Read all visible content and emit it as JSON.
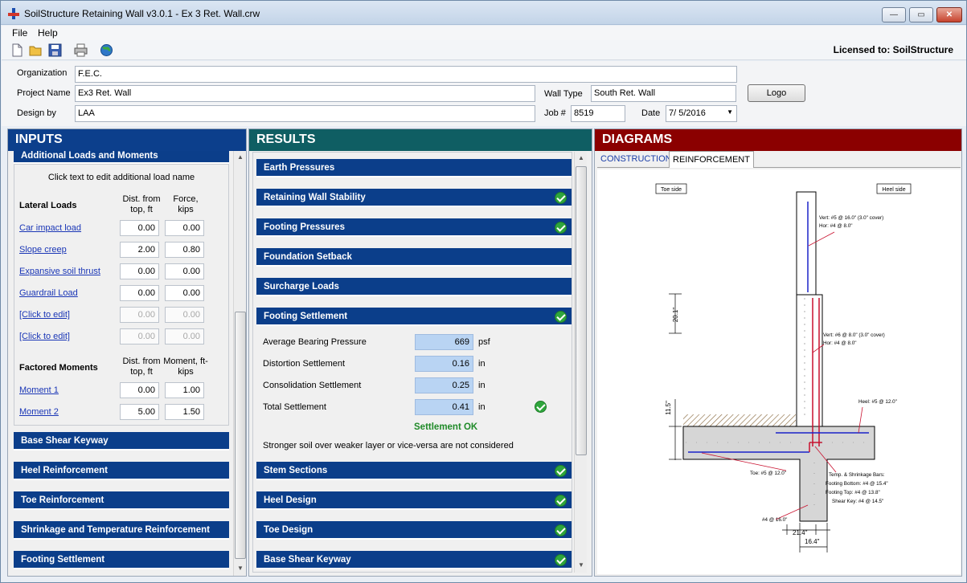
{
  "window": {
    "title": "SoilStructure Retaining Wall v3.0.1 - Ex 3 Ret. Wall.crw"
  },
  "menu": {
    "file": "File",
    "help": "Help"
  },
  "license": "Licensed to: SoilStructure",
  "header": {
    "organization_label": "Organization",
    "organization_value": "F.E.C.",
    "project_label": "Project Name",
    "project_value": "Ex3 Ret. Wall",
    "design_label": "Design by",
    "design_value": "LAA",
    "wall_type_label": "Wall Type",
    "wall_type_value": "South Ret. Wall",
    "job_label": "Job #",
    "job_value": "8519",
    "date_label": "Date",
    "date_value": "7/ 5/2016",
    "logo_button": "Logo"
  },
  "inputs": {
    "title": "INPUTS",
    "section_title": "Additional Loads and Moments",
    "hint": "Click text to edit additional load name",
    "lateral_title": "Lateral Loads",
    "lateral_col1": "Dist. from top, ft",
    "lateral_col2": "Force, kips",
    "lateral_rows": [
      {
        "name": "Car impact load",
        "dist": "0.00",
        "force": "0.00"
      },
      {
        "name": "Slope creep",
        "dist": "2.00",
        "force": "0.80"
      },
      {
        "name": "Expansive soil thrust",
        "dist": "0.00",
        "force": "0.00"
      },
      {
        "name": "Guardrail Load",
        "dist": "0.00",
        "force": "0.00"
      },
      {
        "name": "[Click to edit]",
        "dist": "0.00",
        "force": "0.00"
      },
      {
        "name": "[Click to edit]",
        "dist": "0.00",
        "force": "0.00"
      }
    ],
    "moments_title": "Factored Moments",
    "moments_col1": "Dist. from top, ft",
    "moments_col2": "Moment, ft-kips",
    "moment_rows": [
      {
        "name": "Moment 1",
        "dist": "0.00",
        "moment": "1.00"
      },
      {
        "name": "Moment 2",
        "dist": "5.00",
        "moment": "1.50"
      }
    ],
    "bars": [
      "Base Shear Keyway",
      "Heel Reinforcement",
      "Toe Reinforcement",
      "Shrinkage and Temperature Reinforcement",
      "Footing Settlement"
    ]
  },
  "results": {
    "title": "RESULTS",
    "bars_top": [
      {
        "label": "Earth Pressures",
        "ok": false
      },
      {
        "label": "Retaining Wall Stability",
        "ok": true
      },
      {
        "label": "Footing Pressures",
        "ok": true
      },
      {
        "label": "Foundation Setback",
        "ok": false
      },
      {
        "label": "Surcharge Loads",
        "ok": false
      },
      {
        "label": "Footing Settlement",
        "ok": true
      }
    ],
    "settlement": {
      "rows": [
        {
          "label": "Average Bearing Pressure",
          "value": "669",
          "unit": "psf"
        },
        {
          "label": "Distortion Settlement",
          "value": "0.16",
          "unit": "in"
        },
        {
          "label": "Consolidation Settlement",
          "value": "0.25",
          "unit": "in"
        },
        {
          "label": "Total Settlement",
          "value": "0.41",
          "unit": "in"
        }
      ],
      "status": "Settlement OK",
      "note": "Stronger soil over weaker layer or vice-versa are not considered"
    },
    "bars_bottom": [
      {
        "label": "Stem Sections",
        "ok": true
      },
      {
        "label": "Heel Design",
        "ok": true
      },
      {
        "label": "Toe Design",
        "ok": true
      },
      {
        "label": "Base Shear Keyway",
        "ok": true
      }
    ]
  },
  "diagrams": {
    "title": "DIAGRAMS",
    "tab_construction": "CONSTRUCTION",
    "tab_reinforcement": "REINFORCEMENT",
    "toe_side": "Toe side",
    "heel_side": "Heel side",
    "vert_upper": "Vert: #5 @ 16.0\" (3.0\" cover)",
    "hor_upper": "Hor: #4 @ 8.0\"",
    "vert_lower": "Vert: #6 @ 8.0\" (3.0\" cover)",
    "hor_lower": "Hor: #4 @ 8.0\"",
    "heel_bar": "Heel: #5 @ 12.0\"",
    "toe_bar": "Toe: #5 @ 12.0\"",
    "temp_title": "Temp. & Shrinkage Bars:",
    "temp_bottom": "Footing Bottom: #4 @ 15.4\"",
    "temp_top": "Footing Top: #4 @ 13.8\"",
    "temp_key": "Shear Key: #4 @ 14.5\"",
    "key_bar": "#4 @ 16.0\"",
    "dim_stem": "20.1\"",
    "dim_footing": "11.5\"",
    "dim_toe": "21.4\"",
    "dim_key": "16.4\""
  },
  "colors": {
    "inputs_header": "#0c3f8c",
    "results_header": "#0f5e63",
    "diagrams_header": "#8b0000",
    "bar": "#0b3e8a",
    "check": "#2fa63c"
  }
}
